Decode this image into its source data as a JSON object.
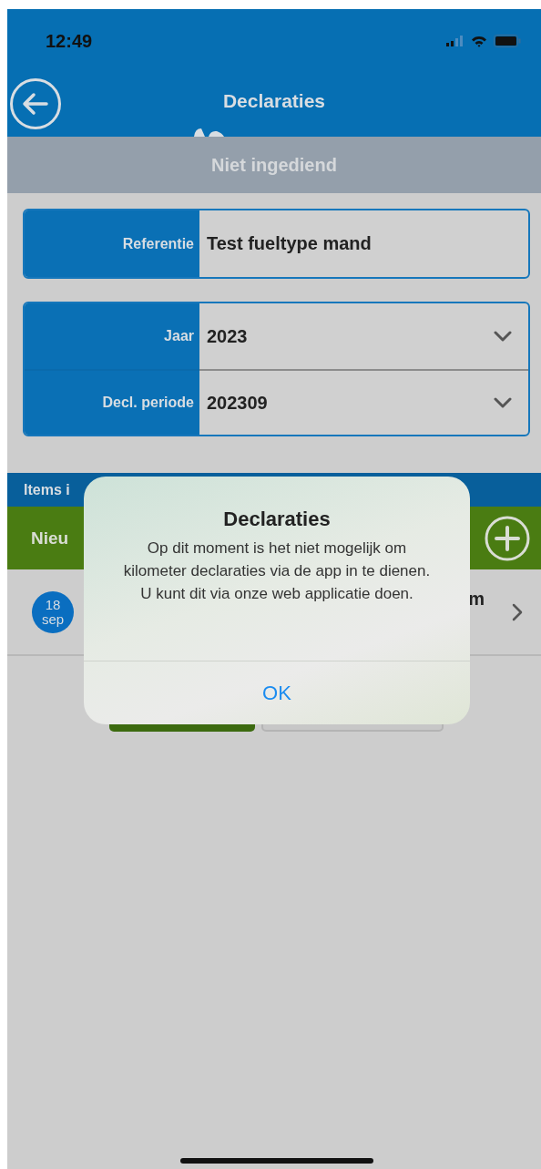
{
  "status_bar": {
    "time": "12:49"
  },
  "nav": {
    "title": "Declaraties",
    "loading": true
  },
  "subheader": {
    "title": "Niet ingediend"
  },
  "reference": {
    "label": "Referentie",
    "value": "Test fueltype mand"
  },
  "period_fields": [
    {
      "label": "Jaar",
      "value": "2023"
    },
    {
      "label": "Decl. periode",
      "value": "202309"
    }
  ],
  "items_section": {
    "title": "Items i",
    "new_label": "Nieu"
  },
  "items": [
    {
      "day": "18",
      "month": "sep",
      "title": "m"
    }
  ],
  "alert": {
    "title": "Declaraties",
    "message": "Op dit moment is het niet mogelijk om kilometer declaraties via de app in te dienen. U kunt dit via onze web applicatie doen.",
    "button": "OK"
  }
}
